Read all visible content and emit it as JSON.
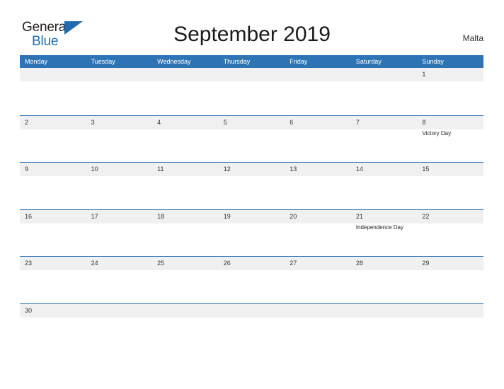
{
  "header": {
    "logo": {
      "text_primary": "General",
      "text_secondary": "Blue",
      "color_primary": "#231f20",
      "color_secondary": "#1f6cb0"
    },
    "title": "September 2019",
    "country": "Malta"
  },
  "theme": {
    "header_blue": "#2e74b5",
    "row_border_blue": "#2e74b5",
    "date_band_gray": "#f0f0f0",
    "page_background": "#ffffff",
    "text_dark": "#333333"
  },
  "calendar": {
    "month": "September",
    "year": "2019",
    "weekday_headers": [
      "Monday",
      "Tuesday",
      "Wednesday",
      "Thursday",
      "Friday",
      "Saturday",
      "Sunday"
    ],
    "weeks": [
      [
        {
          "day": "",
          "event": ""
        },
        {
          "day": "",
          "event": ""
        },
        {
          "day": "",
          "event": ""
        },
        {
          "day": "",
          "event": ""
        },
        {
          "day": "",
          "event": ""
        },
        {
          "day": "",
          "event": ""
        },
        {
          "day": "1",
          "event": ""
        }
      ],
      [
        {
          "day": "2",
          "event": ""
        },
        {
          "day": "3",
          "event": ""
        },
        {
          "day": "4",
          "event": ""
        },
        {
          "day": "5",
          "event": ""
        },
        {
          "day": "6",
          "event": ""
        },
        {
          "day": "7",
          "event": ""
        },
        {
          "day": "8",
          "event": "Victory Day"
        }
      ],
      [
        {
          "day": "9",
          "event": ""
        },
        {
          "day": "10",
          "event": ""
        },
        {
          "day": "11",
          "event": ""
        },
        {
          "day": "12",
          "event": ""
        },
        {
          "day": "13",
          "event": ""
        },
        {
          "day": "14",
          "event": ""
        },
        {
          "day": "15",
          "event": ""
        }
      ],
      [
        {
          "day": "16",
          "event": ""
        },
        {
          "day": "17",
          "event": ""
        },
        {
          "day": "18",
          "event": ""
        },
        {
          "day": "19",
          "event": ""
        },
        {
          "day": "20",
          "event": ""
        },
        {
          "day": "21",
          "event": "Independence Day"
        },
        {
          "day": "22",
          "event": ""
        }
      ],
      [
        {
          "day": "23",
          "event": ""
        },
        {
          "day": "24",
          "event": ""
        },
        {
          "day": "25",
          "event": ""
        },
        {
          "day": "26",
          "event": ""
        },
        {
          "day": "27",
          "event": ""
        },
        {
          "day": "28",
          "event": ""
        },
        {
          "day": "29",
          "event": ""
        }
      ],
      [
        {
          "day": "30",
          "event": ""
        },
        {
          "day": "",
          "event": ""
        },
        {
          "day": "",
          "event": ""
        },
        {
          "day": "",
          "event": ""
        },
        {
          "day": "",
          "event": ""
        },
        {
          "day": "",
          "event": ""
        },
        {
          "day": "",
          "event": ""
        }
      ]
    ]
  }
}
